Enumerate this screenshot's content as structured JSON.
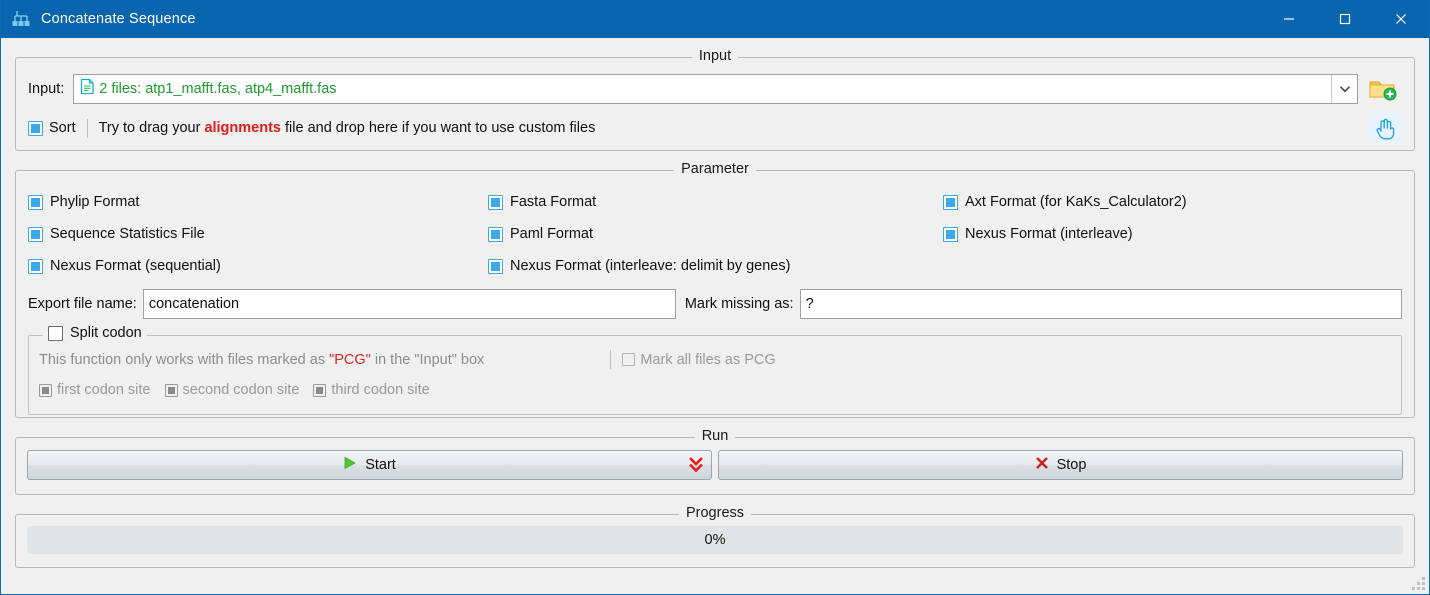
{
  "window": {
    "title": "Concatenate Sequence",
    "app_icon": "phylo-tree-icon",
    "controls": {
      "minimize": "─",
      "maximize": "☐",
      "close": "✕"
    }
  },
  "input_group": {
    "legend": "Input",
    "label": "Input:",
    "combo_value": "2 files: atp1_mafft.fas, atp4_mafft.fas",
    "combo_value_color": "#1f9a2f",
    "file_icon": "document-icon",
    "dropdown_icon": "chevron-down-icon",
    "folder_icon": "folder-add-icon",
    "hand_icon": "hand-pointer-icon",
    "sort_label": "Sort",
    "sort_checked": true,
    "drop_hint_prefix": "Try to drag your ",
    "drop_hint_highlight": "alignments",
    "drop_hint_suffix": " file and drop here if you want to use custom files",
    "highlight_color": "#e21b1b"
  },
  "parameter_group": {
    "legend": "Parameter",
    "checkboxes": [
      {
        "label": "Phylip Format",
        "checked": true
      },
      {
        "label": "Fasta Format",
        "checked": true
      },
      {
        "label": "Axt Format (for KaKs_Calculator2)",
        "checked": true
      },
      {
        "label": "Sequence Statistics File",
        "checked": true
      },
      {
        "label": "Paml Format",
        "checked": true
      },
      {
        "label": "Nexus Format (interleave)",
        "checked": true
      },
      {
        "label": "Nexus Format (sequential)",
        "checked": true
      },
      {
        "label": "Nexus Format (interleave: delimit by genes)",
        "checked": true
      },
      {
        "label": "",
        "checked": false
      }
    ],
    "export_label": "Export file name:",
    "export_value": "concatenation",
    "mark_missing_label": "Mark missing as:",
    "mark_missing_value": "?",
    "split_codon": {
      "title": "Split codon",
      "checked": false,
      "note_part1": "This function only works with files marked as ",
      "note_pcg": "\"PCG\"",
      "note_part2": " in the \"Input\" box",
      "pcg_color": "#e02424",
      "mark_all_label": "Mark all files as PCG",
      "mark_all_checked": false,
      "sites": [
        {
          "label": "first codon site",
          "checked": true,
          "disabled": true
        },
        {
          "label": "second codon site",
          "checked": true,
          "disabled": true
        },
        {
          "label": "third codon site",
          "checked": true,
          "disabled": true
        }
      ]
    }
  },
  "run_group": {
    "legend": "Run",
    "start_label": "Start",
    "start_icon": "play-icon",
    "start_extra_icon": "double-chevron-down-icon",
    "stop_label": "Stop",
    "stop_icon": "close-x-icon",
    "start_icon_color": "#3fbf22",
    "stop_icon_color": "#cc2222",
    "chevron_color": "#e81c1c"
  },
  "progress_group": {
    "legend": "Progress",
    "percent_label": "0%",
    "percent_value": 0
  }
}
